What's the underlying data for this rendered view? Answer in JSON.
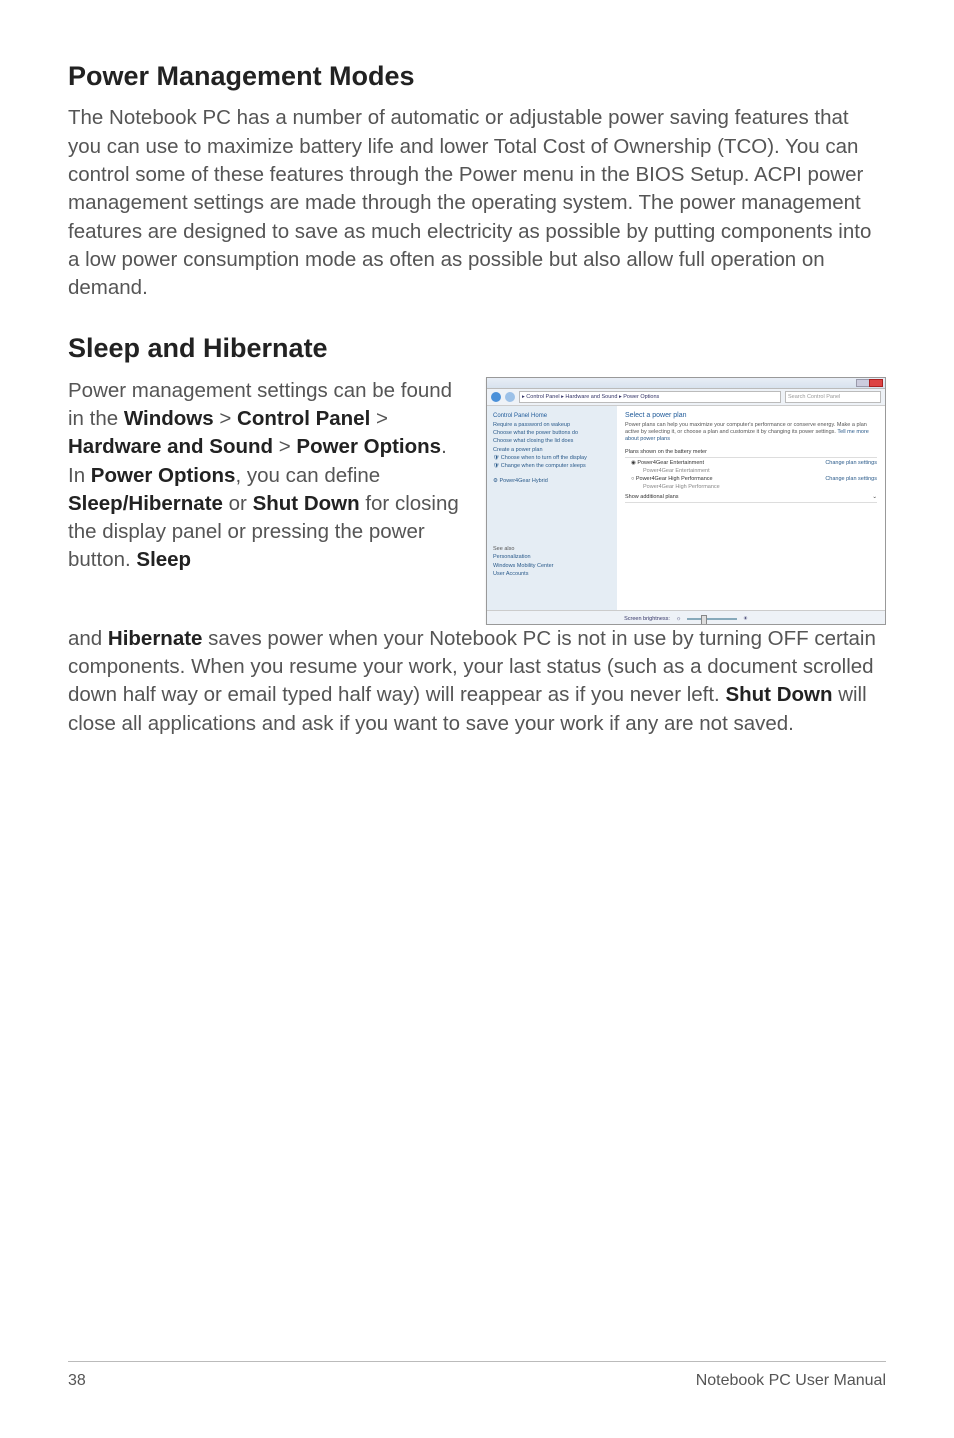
{
  "headings": {
    "h1": "Power Management Modes",
    "h2": "Sleep and Hibernate"
  },
  "paragraphs": {
    "p1": "The Notebook PC has a number of automatic or adjustable power saving features that you can use to maximize battery life and lower Total Cost of Ownership (TCO). You can control some of these features through the Power menu in the BIOS Setup. ACPI power management settings are made through the operating system. The power management features are designed to save as much electricity as possible by putting components into a low power consumption mode as often as possible but also allow full operation on demand.",
    "p2_a": "Power management settings can be found in the ",
    "p2_b": "Windows",
    "p2_c": " > ",
    "p2_d": "Control Panel",
    "p2_e": " > ",
    "p2_f": "Hardware and Sound",
    "p2_g": " > ",
    "p2_h": "Power Options",
    "p2_i": ". In ",
    "p2_j": "Power Options",
    "p2_k": ", you can define ",
    "p2_l": "Sleep/Hibernate",
    "p2_m": " or ",
    "p2_n": "Shut Down",
    "p2_o": " for closing the display panel or pressing the power button. ",
    "p2_p": "Sleep",
    "p3_a": "and ",
    "p3_b": "Hibernate",
    "p3_c": " saves power when your Notebook PC is not in use by turning OFF certain components. When you resume your work, your last status (such as a document scrolled down half way or email typed half way) will reappear as if you never left. ",
    "p3_d": "Shut Down",
    "p3_e": " will close all applications and ask if you want to save your work if any are not saved."
  },
  "figure": {
    "breadcrumb": "▸ Control Panel ▸ Hardware and Sound ▸ Power Options",
    "search_placeholder": "Search Control Panel",
    "sidebar": {
      "home": "Control Panel Home",
      "links": [
        "Require a password on wakeup",
        "Choose what the power buttons do",
        "Choose what closing the lid does",
        "Create a power plan",
        "Choose when to turn off the display",
        "Change when the computer sleeps"
      ],
      "hybrid": "Power4Gear Hybrid",
      "seealso_hdr": "See also",
      "seealso": [
        "Personalization",
        "Windows Mobility Center",
        "User Accounts"
      ]
    },
    "main": {
      "title": "Select a power plan",
      "desc": "Power plans can help you maximize your computer's performance or conserve energy. Make a plan active by selecting it, or choose a plan and customize it by changing its power settings. ",
      "desc_link": "Tell me more about power plans",
      "plans_header": "Plans shown on the battery meter",
      "plan1": "Power4Gear Entertainment",
      "plan1b": "Power4Gear Entertainment",
      "plan2": "Power4Gear High Performance",
      "plan2b": "Power4Gear High Performance",
      "change": "Change plan settings",
      "show_additional": "Show additional plans",
      "brightness": "Screen brightness:"
    }
  },
  "footer": {
    "page": "38",
    "title": "Notebook PC User Manual"
  }
}
